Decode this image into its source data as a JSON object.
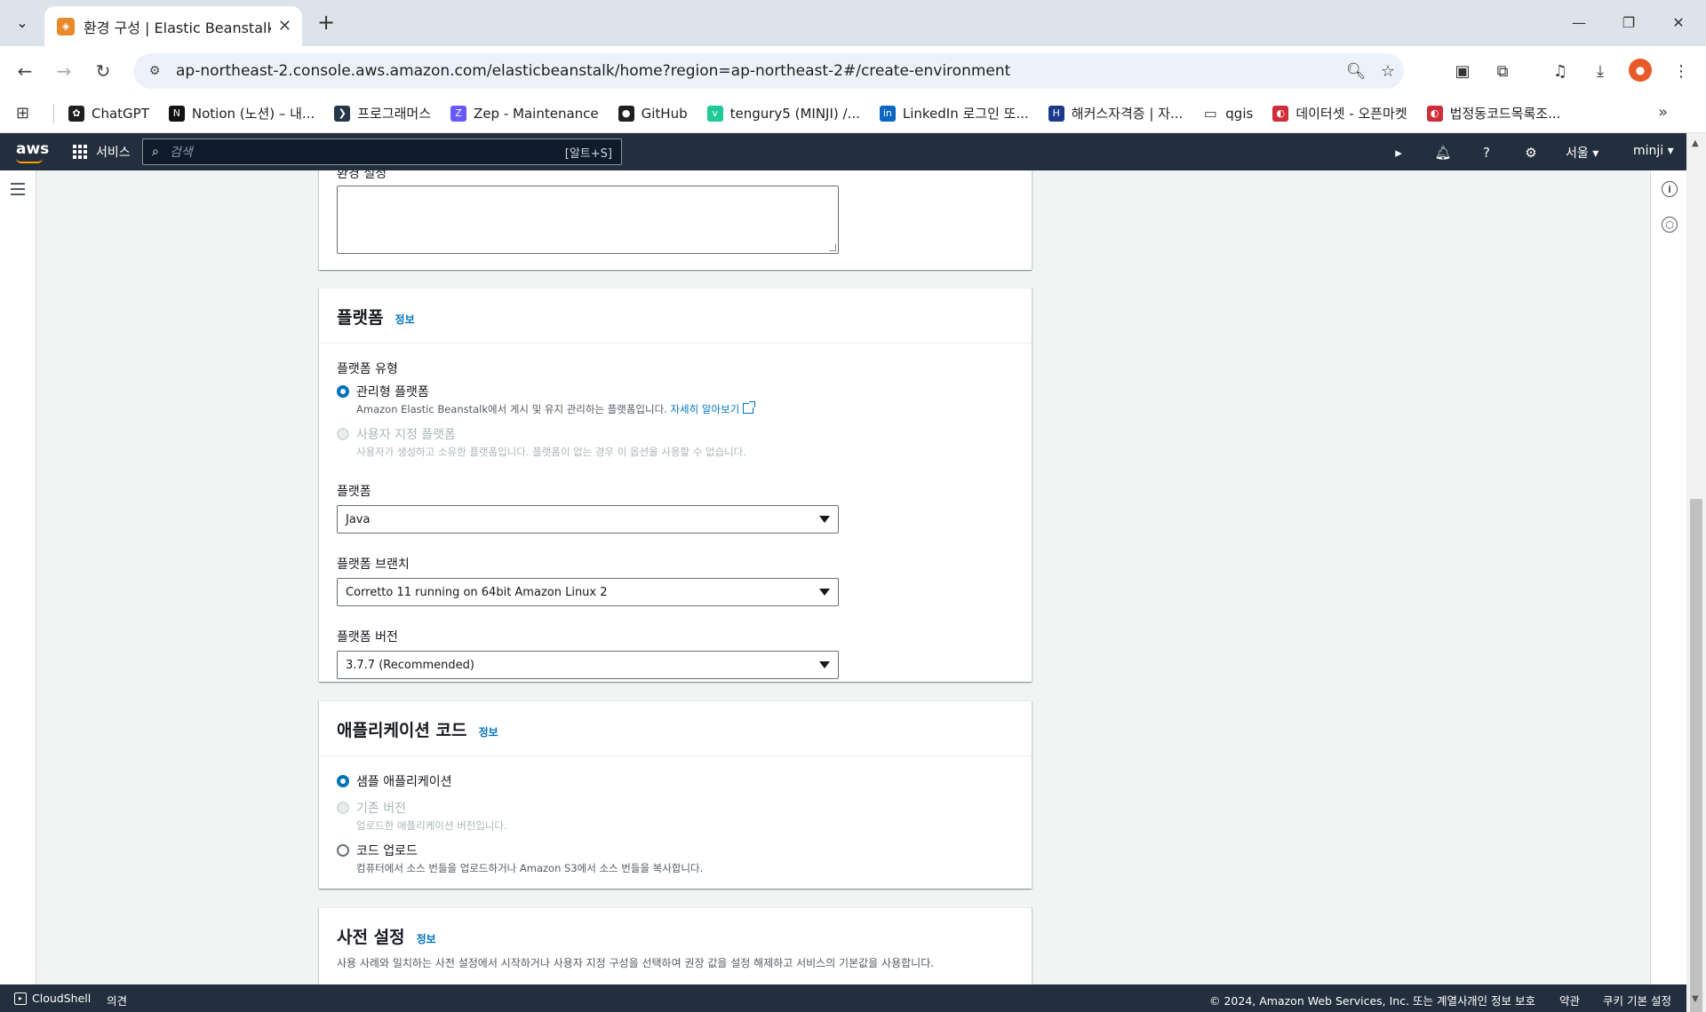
{
  "browser": {
    "tab_title": "환경 구성 | Elastic Beanstalk | ...",
    "url": "ap-northeast-2.console.aws.amazon.com/elasticbeanstalk/home?region=ap-northeast-2#/create-environment",
    "bookmarks": [
      {
        "label": "ChatGPT",
        "icon": "chatgpt-icon",
        "color": "#1f1f1f"
      },
      {
        "label": "Notion (노션) – 내...",
        "icon": "notion-icon",
        "color": "#111111"
      },
      {
        "label": "프로그래머스",
        "icon": "programmers-icon",
        "color": "#263747"
      },
      {
        "label": "Zep - Maintenance",
        "icon": "zep-icon",
        "color": "#6758ff"
      },
      {
        "label": "GitHub",
        "icon": "github-icon",
        "color": "#1f1f1f"
      },
      {
        "label": "tengury5 (MINJI) /...",
        "icon": "velog-icon",
        "color": "#20c997"
      },
      {
        "label": "LinkedIn 로그인 또...",
        "icon": "linkedin-icon",
        "color": "#0a66c2"
      },
      {
        "label": "해커스자격증 | 자...",
        "icon": "hackers-icon",
        "color": "#1b3a8a"
      },
      {
        "label": "qgis",
        "icon": "folder-icon",
        "color": "#444444"
      },
      {
        "label": "데이터셋 - 오픈마켓",
        "icon": "korea-icon",
        "color": "#cd2e3a"
      },
      {
        "label": "법정동코드목록조...",
        "icon": "korea-icon",
        "color": "#cd2e3a"
      }
    ]
  },
  "aws_header": {
    "logo": "aws",
    "services_label": "서비스",
    "search_placeholder": "검색",
    "search_shortcut": "[알트+S]",
    "region": "서울 ▾",
    "account": "minji ▾"
  },
  "env_settings": {
    "label": "환경 설정"
  },
  "platform": {
    "title": "플랫폼",
    "info": "정보",
    "type_label": "플랫폼 유형",
    "managed_label": "관리형 플랫폼",
    "managed_desc": "Amazon Elastic Beanstalk에서 게시 및 유지 관리하는 플랫폼입니다. ",
    "learn_more": "자세히 알아보기",
    "custom_label": "사용자 지정 플랫폼",
    "custom_desc": "사용자가 생성하고 소유한 플랫폼입니다. 플랫폼이 없는 경우 이 옵션을 사용할 수 없습니다.",
    "platform_label": "플랫폼",
    "platform_value": "Java",
    "branch_label": "플랫폼 브랜치",
    "branch_value": "Corretto 11 running on 64bit Amazon Linux 2",
    "version_label": "플랫폼 버전",
    "version_value": "3.7.7 (Recommended)"
  },
  "app_code": {
    "title": "애플리케이션 코드",
    "info": "정보",
    "sample_label": "샘플 애플리케이션",
    "existing_label": "기존 버전",
    "existing_desc": "업로드한 애플리케이션 버전입니다.",
    "upload_label": "코드 업로드",
    "upload_desc": "컴퓨터에서 소스 번들을 업로드하거나 Amazon S3에서 소스 번들을 복사합니다."
  },
  "presets": {
    "title": "사전 설정",
    "info": "정보",
    "desc": "사용 사례와 일치하는 사전 설정에서 시작하거나 사용자 지정 구성을 선택하여 권장 값을 설정 해제하고 서비스의 기본값을 사용합니다."
  },
  "footer": {
    "cloudshell": "CloudShell",
    "feedback": "의견",
    "copyright": "© 2024, Amazon Web Services, Inc. 또는 계열사.",
    "privacy": "개인 정보 보호",
    "terms": "약관",
    "cookies": "쿠키 기본 설정"
  }
}
